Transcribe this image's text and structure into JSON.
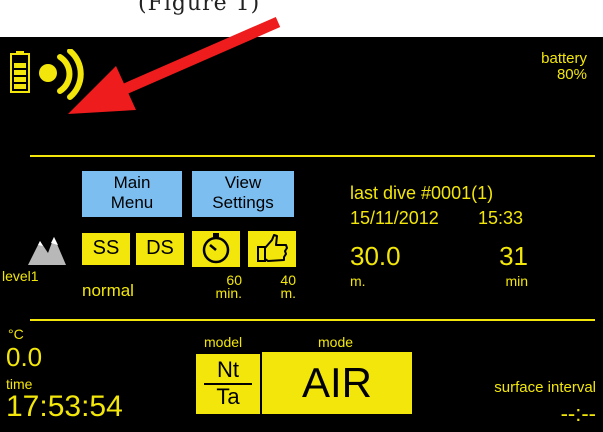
{
  "caption": "(Figure 1)",
  "status": {
    "battery_label": "battery",
    "battery_value": "80%",
    "icons": [
      "battery-icon",
      "bluetooth-signal-icon",
      "red-arrow-annotation"
    ]
  },
  "menu": {
    "main_menu": [
      "Main",
      "Menu"
    ],
    "view_settings": [
      "View",
      "Settings"
    ]
  },
  "toggles": {
    "ss": "SS",
    "ds": "DS"
  },
  "altitude": {
    "level": "level1",
    "mode": "normal"
  },
  "alarms": {
    "time_value": "60",
    "time_unit": "min.",
    "depth_value": "40",
    "depth_unit": "m."
  },
  "last_dive": {
    "title": "last dive  #0001(1)",
    "date": "15/11/2012",
    "time": "15:33",
    "depth": "30.0",
    "depth_unit": "m.",
    "duration": "31",
    "duration_unit": "min"
  },
  "bottom": {
    "temp_unit": "°C",
    "temp_value": "0.0",
    "time_label": "time",
    "time_value": "17:53:54",
    "model_label": "model",
    "model_top": "Nt",
    "model_bottom": "Ta",
    "mode_label": "mode",
    "mode_value": "AIR",
    "surface_label": "surface interval",
    "surface_value": "--:--"
  },
  "colors": {
    "screen_bg": "#000000",
    "accent_yellow": "#f2e60a",
    "button_blue": "#7dbef0",
    "arrow_red": "#ee1c1c"
  }
}
